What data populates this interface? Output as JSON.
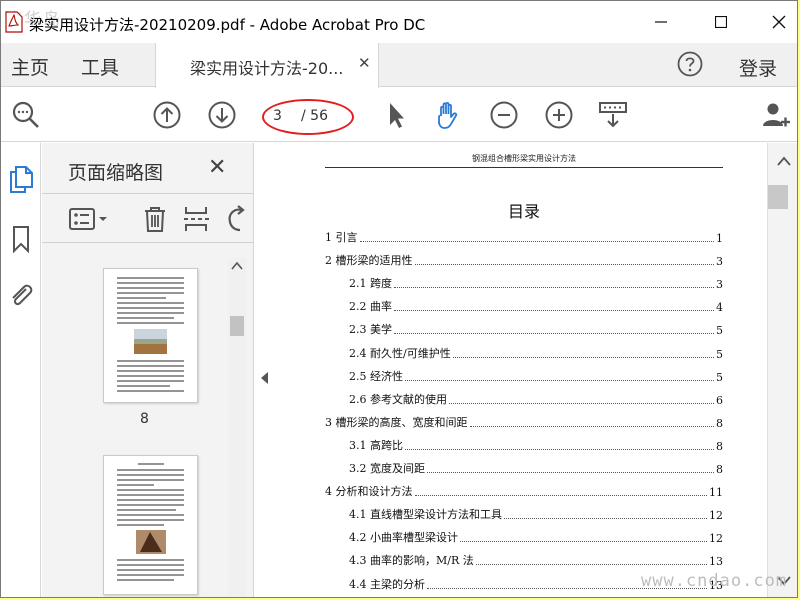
{
  "window": {
    "title": "梁实用设计方法-20210209.pdf - Adobe Acrobat Pro DC",
    "watermark": "连华岛"
  },
  "tabs": {
    "home": "主页",
    "tools": "工具",
    "document_tab": "梁实用设计方法-20...",
    "login": "登录"
  },
  "toolbar": {
    "current_page": "3",
    "total_pages": "/ 56"
  },
  "thumbnails": {
    "title": "页面缩略图",
    "pages": [
      {
        "label": "8"
      },
      {
        "label": ""
      }
    ]
  },
  "document": {
    "header": "钢混组合槽形梁实用设计方法",
    "title": "目录",
    "toc": [
      {
        "text": "1  引言",
        "page": "1",
        "level": 1
      },
      {
        "text": "2  槽形梁的适用性",
        "page": "3",
        "level": 1
      },
      {
        "text": "2.1  跨度",
        "page": "3",
        "level": 2
      },
      {
        "text": "2.2  曲率",
        "page": "4",
        "level": 2
      },
      {
        "text": "2.3  美学",
        "page": "5",
        "level": 2
      },
      {
        "text": "2.4  耐久性/可维护性",
        "page": "5",
        "level": 2
      },
      {
        "text": "2.5  经济性",
        "page": "5",
        "level": 2
      },
      {
        "text": "2.6  参考文献的使用",
        "page": "6",
        "level": 2
      },
      {
        "text": "3  槽形梁的高度、宽度和间距",
        "page": "8",
        "level": 1
      },
      {
        "text": "3.1  高跨比",
        "page": "8",
        "level": 2
      },
      {
        "text": "3.2  宽度及间距",
        "page": "8",
        "level": 2
      },
      {
        "text": "4  分析和设计方法",
        "page": "11",
        "level": 1
      },
      {
        "text": "4.1  直线槽型梁设计方法和工具",
        "page": "12",
        "level": 2
      },
      {
        "text": "4.2  小曲率槽型梁设计",
        "page": "12",
        "level": 2
      },
      {
        "text": "4.3  曲率的影响，M/R 法",
        "page": "13",
        "level": 2
      },
      {
        "text": "4.4  主梁的分析",
        "page": "13",
        "level": 2
      }
    ]
  },
  "site_watermark": "www.cndao.com",
  "colors": {
    "accent_blue": "#2b7bd6",
    "annotation_red": "#e21e1e",
    "icon_gray": "#555555"
  }
}
